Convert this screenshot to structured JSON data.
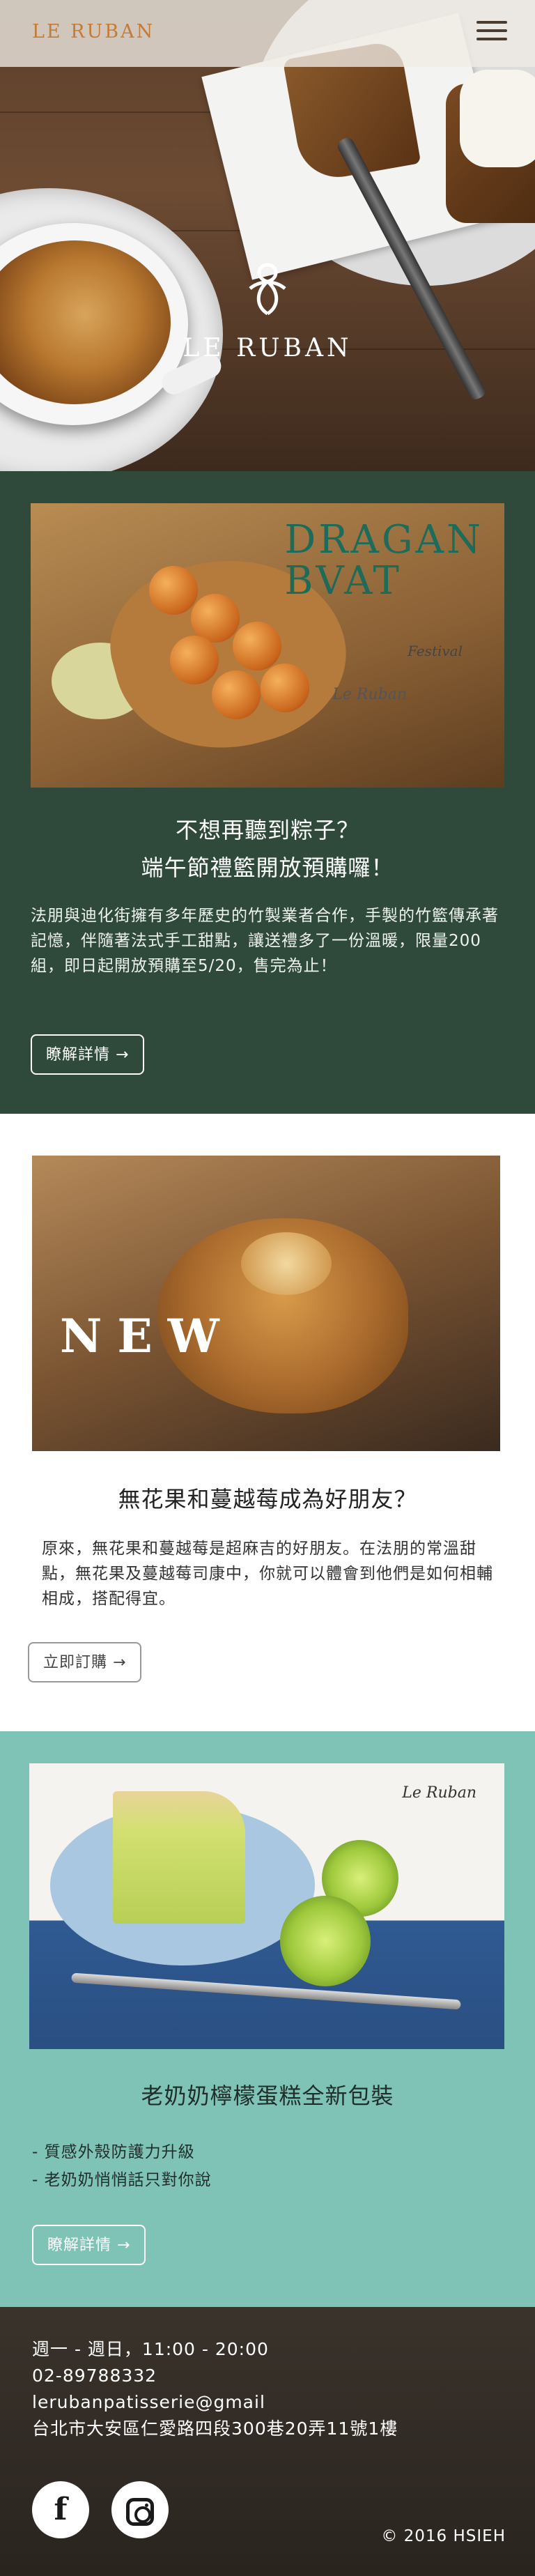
{
  "header": {
    "brand": "LE RUBAN",
    "menu_icon": "hamburger-menu-icon"
  },
  "hero": {
    "logo_icon": "ribbon-logo-icon",
    "brand_name": "LE RUBAN"
  },
  "sections": [
    {
      "image_text": {
        "title_line1": "DRAGAN",
        "title_line2": "BVAT",
        "sub": "Festival",
        "brand": "Le Ruban"
      },
      "heading_line1": "不想再聽到粽子？",
      "heading_line2": "端午節禮籃開放預購囉！",
      "body": "法朋與迪化街擁有多年歷史的竹製業者合作，手製的竹籃傳承著記憶，伴隨著法式手工甜點，讓送禮多了一份溫暖，限量200組，即日起開放預購至5/20，售完為止！",
      "button": "瞭解詳情 →",
      "bg_color": "#2f4a3b"
    },
    {
      "image_text": {
        "overlay": "NEW"
      },
      "heading": "無花果和蔓越莓成為好朋友？",
      "body": "原來，無花果和蔓越莓是超麻吉的好朋友。在法朋的常溫甜點，無花果及蔓越莓司康中，你就可以體會到他們是如何相輔相成，搭配得宜。",
      "button": "立即訂購 →",
      "bg_color": "#ffffff"
    },
    {
      "image_text": {
        "brand": "Le Ruban"
      },
      "heading": "老奶奶檸檬蛋糕全新包裝",
      "list": [
        "- 質感外殼防護力升級",
        "- 老奶奶悄悄話只對你說"
      ],
      "button": "瞭解詳情 →",
      "bg_color": "#7fc2b6"
    }
  ],
  "footer": {
    "hours": "週一 - 週日，11:00 - 20:00",
    "phone": "02-89788332",
    "email": "lerubanpatisserie@gmail",
    "address": "台北市大安區仁愛路四段300巷20弄11號1樓",
    "facebook_icon": "facebook-icon",
    "instagram_icon": "instagram-icon",
    "facebook_glyph": "f",
    "copyright": "© 2016  HSIEH"
  }
}
